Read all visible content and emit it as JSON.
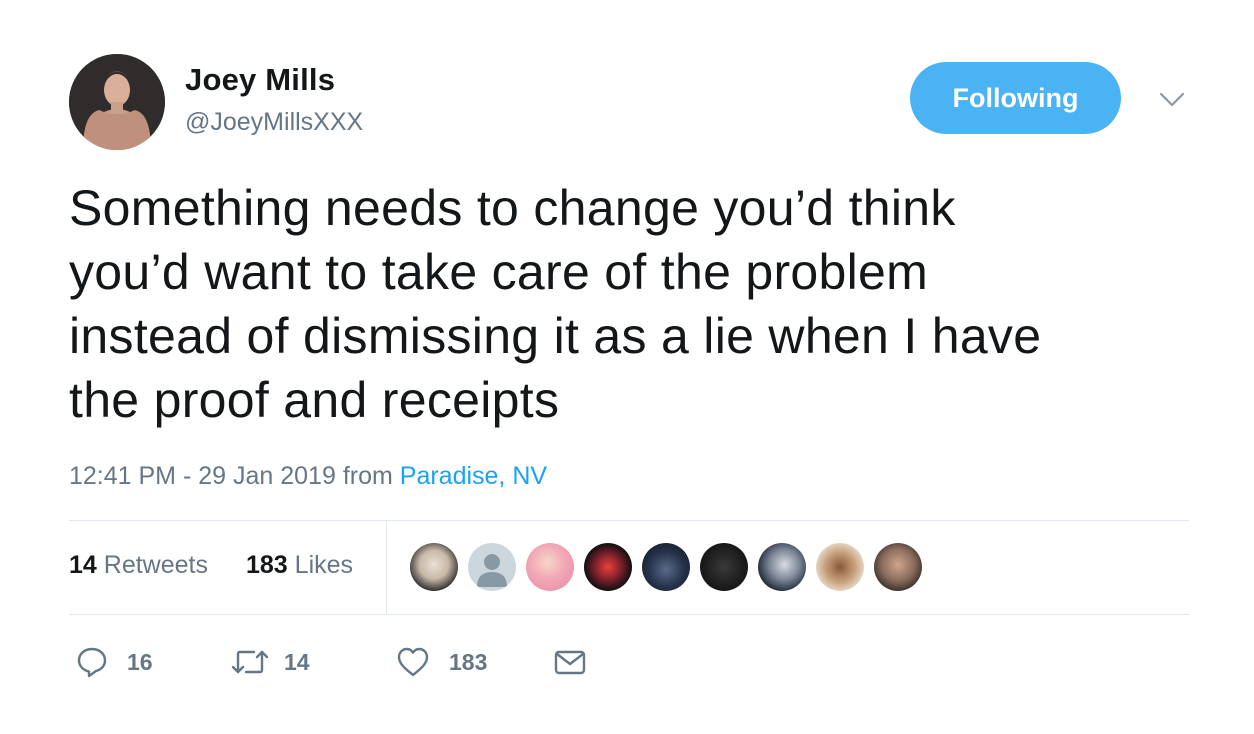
{
  "user": {
    "name": "Joey Mills",
    "handle": "@JoeyMillsXXX"
  },
  "follow_button": {
    "label": "Following",
    "color": "#4ab3f4"
  },
  "tweet": {
    "text_lines": [
      "Something needs to change you’d think",
      "you’d want to take care of the problem",
      "instead of dismissing it as a lie when I have",
      "the proof and receipts"
    ],
    "timestamp": "12:41 PM - 29 Jan 2019",
    "from_label": "from",
    "location": "Paradise, NV"
  },
  "stats": {
    "retweets_count": "14",
    "retweets_label": "Retweets",
    "likes_count": "183",
    "likes_label": "Likes"
  },
  "facepile": {
    "avatar_count": 9
  },
  "actions": {
    "reply": {
      "icon": "reply-icon",
      "count": "16"
    },
    "retweet": {
      "icon": "retweet-icon",
      "count": "14"
    },
    "like": {
      "icon": "heart-icon",
      "count": "183"
    },
    "message": {
      "icon": "envelope-icon"
    }
  },
  "colors": {
    "accent": "#1da1f2",
    "secondary_text": "#657786",
    "divider": "#e1e8ed"
  }
}
